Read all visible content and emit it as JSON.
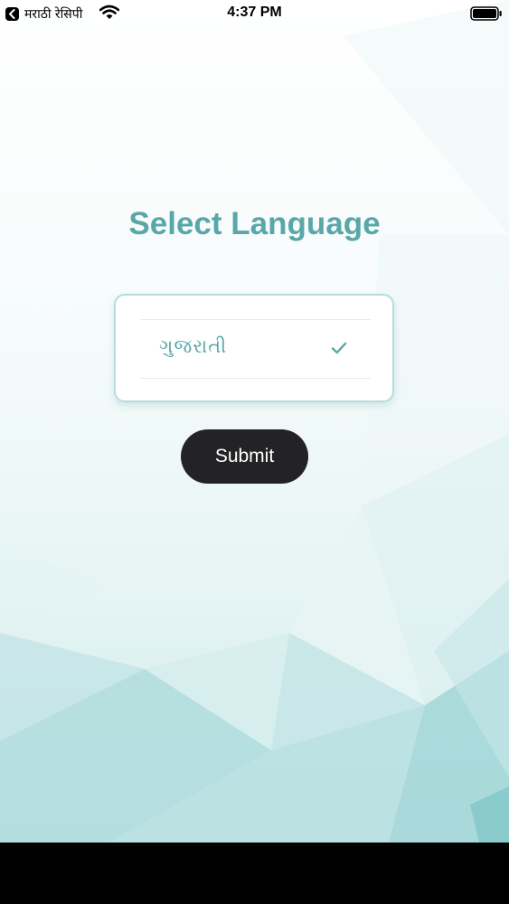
{
  "status_bar": {
    "back_app_label": "मराठी रेसिपी",
    "time": "4:37 PM"
  },
  "page": {
    "title": "Select Language"
  },
  "language_picker": {
    "selected_language": "ગુજરાતી",
    "selected": true
  },
  "submit": {
    "label": "Submit"
  },
  "colors": {
    "accent": "#5aa7a9",
    "button_bg": "#232325",
    "card_border": "#b4dddd"
  }
}
